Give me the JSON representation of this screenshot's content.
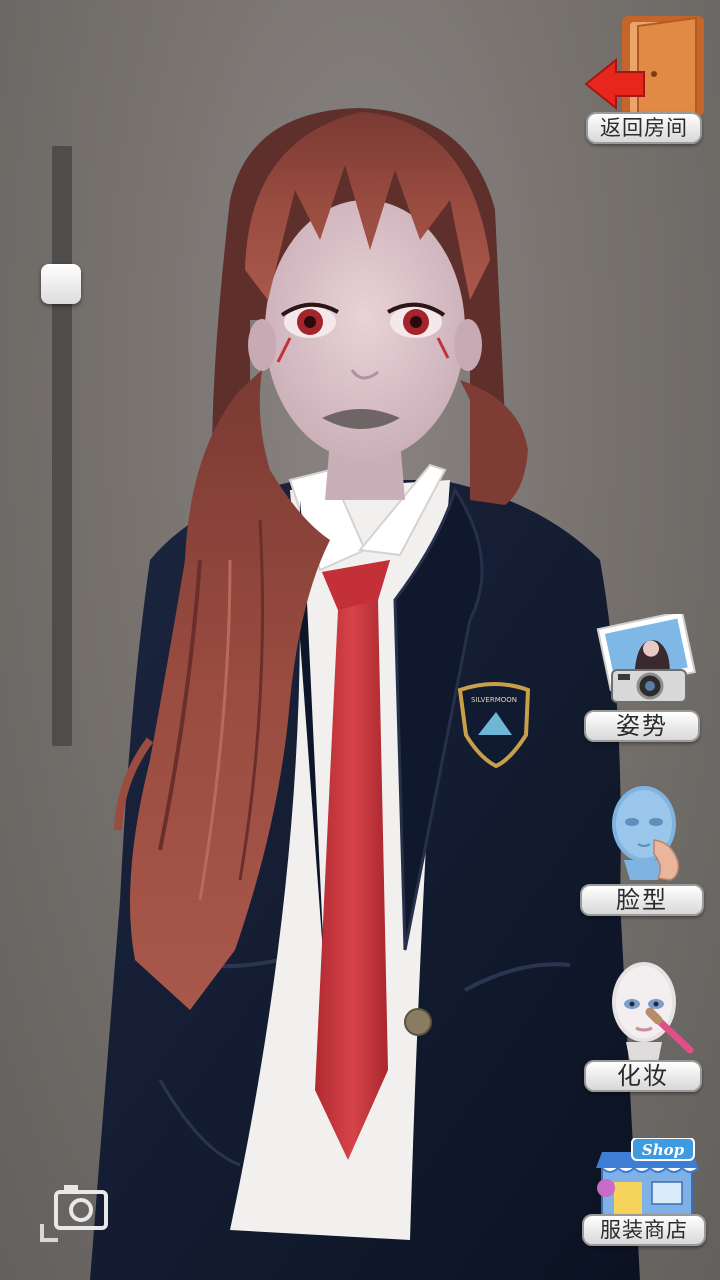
{
  "nav": {
    "back_label": "返回房间"
  },
  "zoom": {
    "level": 0.21
  },
  "menu": {
    "pose_label": "姿势",
    "face_label": "脸型",
    "makeup_label": "化妆",
    "shop_label": "服装商店",
    "shop_sign": "Shop"
  },
  "character": {
    "badge_text": "SILVERMOON"
  },
  "colors": {
    "background": "#78736f",
    "hair": "#8b4136",
    "blazer": "#101a30",
    "tie": "#c8353a",
    "shirt": "#f2f0ee",
    "back_arrow": "#e8261c",
    "door": "#d9772e"
  },
  "icons": {
    "back": "door-exit-icon",
    "pose": "camera-photo-icon",
    "face": "head-model-icon",
    "makeup": "makeup-brush-icon",
    "shop": "shop-storefront-icon",
    "screenshot": "camera-icon"
  }
}
